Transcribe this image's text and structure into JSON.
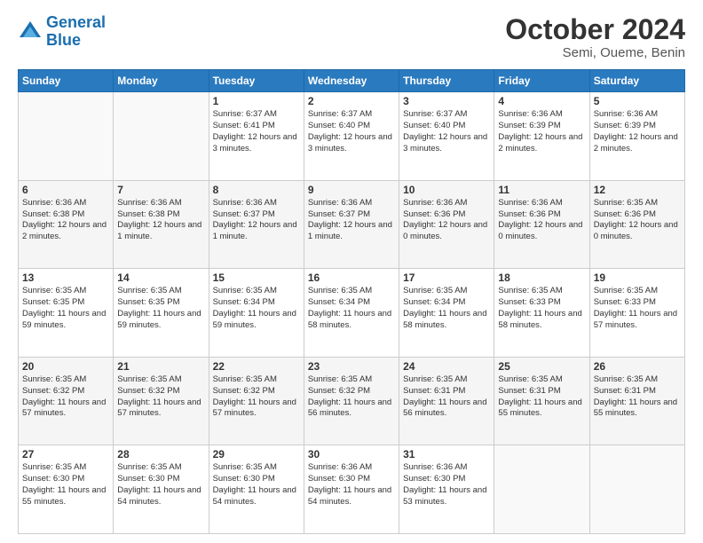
{
  "logo": {
    "line1": "General",
    "line2": "Blue"
  },
  "title": "October 2024",
  "subtitle": "Semi, Oueme, Benin",
  "days_of_week": [
    "Sunday",
    "Monday",
    "Tuesday",
    "Wednesday",
    "Thursday",
    "Friday",
    "Saturday"
  ],
  "weeks": [
    [
      {
        "day": "",
        "info": ""
      },
      {
        "day": "",
        "info": ""
      },
      {
        "day": "1",
        "info": "Sunrise: 6:37 AM\nSunset: 6:41 PM\nDaylight: 12 hours and 3 minutes."
      },
      {
        "day": "2",
        "info": "Sunrise: 6:37 AM\nSunset: 6:40 PM\nDaylight: 12 hours and 3 minutes."
      },
      {
        "day": "3",
        "info": "Sunrise: 6:37 AM\nSunset: 6:40 PM\nDaylight: 12 hours and 3 minutes."
      },
      {
        "day": "4",
        "info": "Sunrise: 6:36 AM\nSunset: 6:39 PM\nDaylight: 12 hours and 2 minutes."
      },
      {
        "day": "5",
        "info": "Sunrise: 6:36 AM\nSunset: 6:39 PM\nDaylight: 12 hours and 2 minutes."
      }
    ],
    [
      {
        "day": "6",
        "info": "Sunrise: 6:36 AM\nSunset: 6:38 PM\nDaylight: 12 hours and 2 minutes."
      },
      {
        "day": "7",
        "info": "Sunrise: 6:36 AM\nSunset: 6:38 PM\nDaylight: 12 hours and 1 minute."
      },
      {
        "day": "8",
        "info": "Sunrise: 6:36 AM\nSunset: 6:37 PM\nDaylight: 12 hours and 1 minute."
      },
      {
        "day": "9",
        "info": "Sunrise: 6:36 AM\nSunset: 6:37 PM\nDaylight: 12 hours and 1 minute."
      },
      {
        "day": "10",
        "info": "Sunrise: 6:36 AM\nSunset: 6:36 PM\nDaylight: 12 hours and 0 minutes."
      },
      {
        "day": "11",
        "info": "Sunrise: 6:36 AM\nSunset: 6:36 PM\nDaylight: 12 hours and 0 minutes."
      },
      {
        "day": "12",
        "info": "Sunrise: 6:35 AM\nSunset: 6:36 PM\nDaylight: 12 hours and 0 minutes."
      }
    ],
    [
      {
        "day": "13",
        "info": "Sunrise: 6:35 AM\nSunset: 6:35 PM\nDaylight: 11 hours and 59 minutes."
      },
      {
        "day": "14",
        "info": "Sunrise: 6:35 AM\nSunset: 6:35 PM\nDaylight: 11 hours and 59 minutes."
      },
      {
        "day": "15",
        "info": "Sunrise: 6:35 AM\nSunset: 6:34 PM\nDaylight: 11 hours and 59 minutes."
      },
      {
        "day": "16",
        "info": "Sunrise: 6:35 AM\nSunset: 6:34 PM\nDaylight: 11 hours and 58 minutes."
      },
      {
        "day": "17",
        "info": "Sunrise: 6:35 AM\nSunset: 6:34 PM\nDaylight: 11 hours and 58 minutes."
      },
      {
        "day": "18",
        "info": "Sunrise: 6:35 AM\nSunset: 6:33 PM\nDaylight: 11 hours and 58 minutes."
      },
      {
        "day": "19",
        "info": "Sunrise: 6:35 AM\nSunset: 6:33 PM\nDaylight: 11 hours and 57 minutes."
      }
    ],
    [
      {
        "day": "20",
        "info": "Sunrise: 6:35 AM\nSunset: 6:32 PM\nDaylight: 11 hours and 57 minutes."
      },
      {
        "day": "21",
        "info": "Sunrise: 6:35 AM\nSunset: 6:32 PM\nDaylight: 11 hours and 57 minutes."
      },
      {
        "day": "22",
        "info": "Sunrise: 6:35 AM\nSunset: 6:32 PM\nDaylight: 11 hours and 57 minutes."
      },
      {
        "day": "23",
        "info": "Sunrise: 6:35 AM\nSunset: 6:32 PM\nDaylight: 11 hours and 56 minutes."
      },
      {
        "day": "24",
        "info": "Sunrise: 6:35 AM\nSunset: 6:31 PM\nDaylight: 11 hours and 56 minutes."
      },
      {
        "day": "25",
        "info": "Sunrise: 6:35 AM\nSunset: 6:31 PM\nDaylight: 11 hours and 55 minutes."
      },
      {
        "day": "26",
        "info": "Sunrise: 6:35 AM\nSunset: 6:31 PM\nDaylight: 11 hours and 55 minutes."
      }
    ],
    [
      {
        "day": "27",
        "info": "Sunrise: 6:35 AM\nSunset: 6:30 PM\nDaylight: 11 hours and 55 minutes."
      },
      {
        "day": "28",
        "info": "Sunrise: 6:35 AM\nSunset: 6:30 PM\nDaylight: 11 hours and 54 minutes."
      },
      {
        "day": "29",
        "info": "Sunrise: 6:35 AM\nSunset: 6:30 PM\nDaylight: 11 hours and 54 minutes."
      },
      {
        "day": "30",
        "info": "Sunrise: 6:36 AM\nSunset: 6:30 PM\nDaylight: 11 hours and 54 minutes."
      },
      {
        "day": "31",
        "info": "Sunrise: 6:36 AM\nSunset: 6:30 PM\nDaylight: 11 hours and 53 minutes."
      },
      {
        "day": "",
        "info": ""
      },
      {
        "day": "",
        "info": ""
      }
    ]
  ]
}
